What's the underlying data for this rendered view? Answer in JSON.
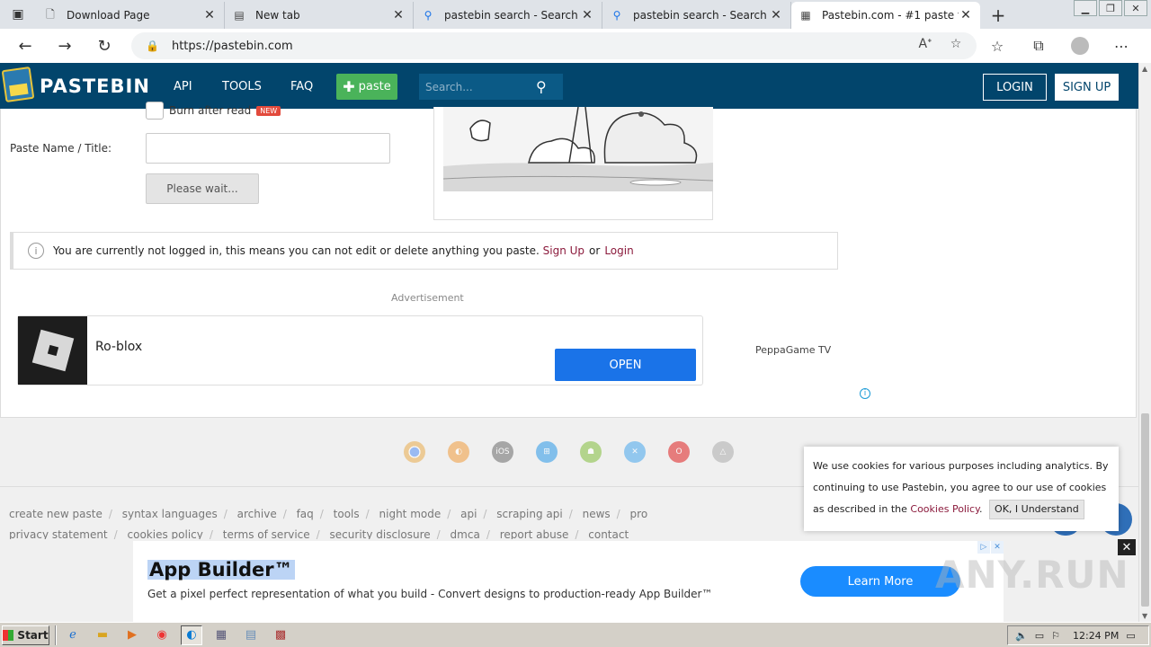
{
  "browser": {
    "tabs": [
      {
        "label": "Download Page",
        "icon": "page-icon",
        "active": false
      },
      {
        "label": "New tab",
        "icon": "newtab-icon",
        "active": false
      },
      {
        "label": "pastebin search - Search",
        "icon": "search-icon",
        "active": false
      },
      {
        "label": "pastebin search - Search",
        "icon": "search-icon",
        "active": false
      },
      {
        "label": "Pastebin.com - #1 paste t",
        "icon": "pastebin-icon",
        "active": true
      }
    ],
    "url": "https://pastebin.com"
  },
  "header": {
    "brand": "PASTEBIN",
    "nav": [
      "API",
      "TOOLS",
      "FAQ"
    ],
    "paste_label": "paste",
    "search_placeholder": "Search...",
    "login": "LOGIN",
    "signup": "SIGN UP"
  },
  "form": {
    "burn_label": "Burn after read",
    "new_badge": "NEW",
    "paste_name_label": "Paste Name / Title:",
    "wait_button": "Please wait..."
  },
  "notice": {
    "text": "You are currently not logged in, this means you can not edit or delete anything you paste.",
    "signup_link": "Sign Up",
    "or": "or",
    "login_link": "Login"
  },
  "ad": {
    "label": "Advertisement",
    "app_name": "Ro-blox",
    "open_button": "OPEN",
    "side_text": "PeppaGame TV"
  },
  "platforms": [
    {
      "name": "chrome-icon",
      "color": "#e8a33a"
    },
    {
      "name": "firefox-icon",
      "color": "#f0a24a"
    },
    {
      "name": "ios-icon",
      "color": "#888888"
    },
    {
      "name": "windows-icon",
      "color": "#3aa0e8"
    },
    {
      "name": "android-icon",
      "color": "#8bc34a"
    },
    {
      "name": "x-icon",
      "color": "#55acee"
    },
    {
      "name": "opera-icon",
      "color": "#e03030"
    },
    {
      "name": "linux-icon",
      "color": "#bbbbbb"
    }
  ],
  "footer": {
    "links_row1": [
      "create new paste",
      "syntax languages",
      "archive",
      "faq",
      "tools",
      "night mode",
      "api",
      "scraping api",
      "news",
      "pro"
    ],
    "links_row2": [
      "privacy statement",
      "cookies policy",
      "terms of service",
      "security disclosure",
      "dmca",
      "report abuse",
      "contact"
    ]
  },
  "cookie": {
    "text": "We use cookies for various purposes including analytics. By continuing to use Pastebin, you agree to our use of cookies as described in the",
    "link": "Cookies Policy",
    "ok": "OK, I Understand"
  },
  "banner": {
    "title": "App Builder™",
    "description": "Get a pixel perfect representation of what you build - Convert designs to production-ready App Builder™",
    "cta": "Learn More"
  },
  "watermark": "ANY.RUN",
  "taskbar": {
    "start": "Start",
    "time": "12:24 PM"
  }
}
